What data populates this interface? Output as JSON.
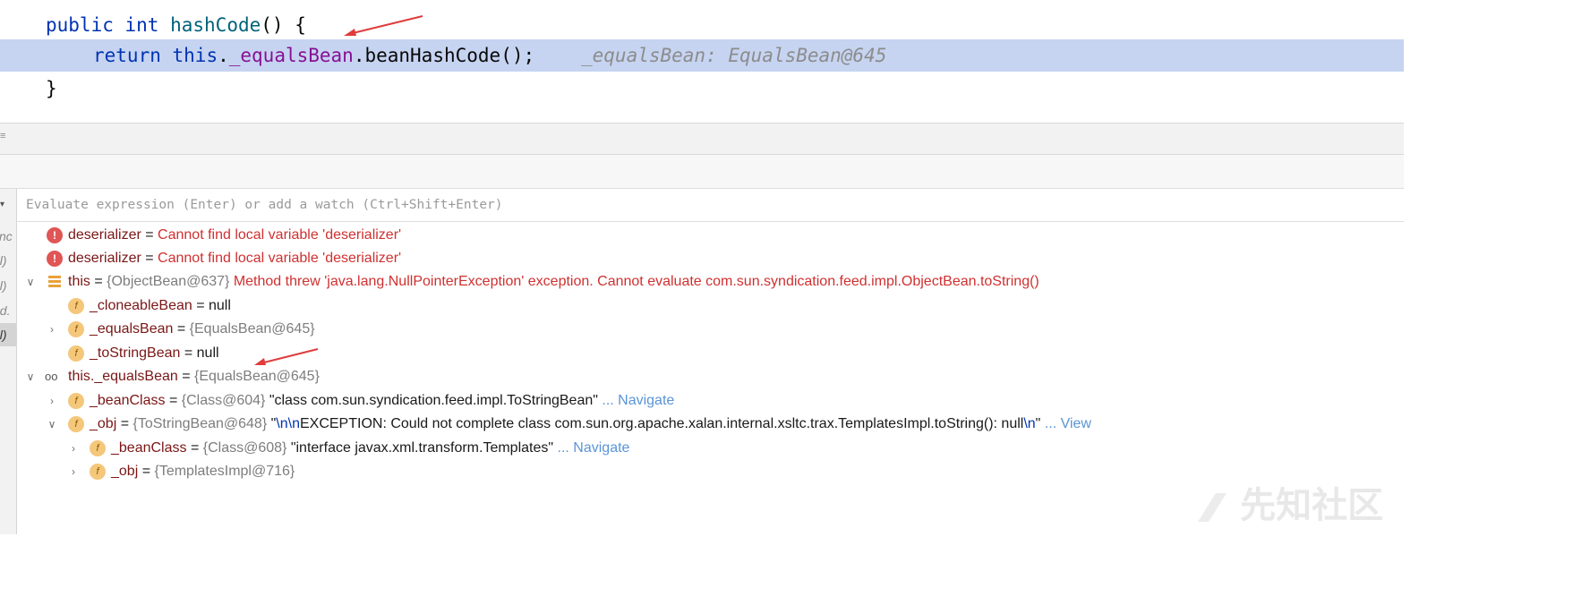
{
  "editor": {
    "line1": {
      "kw_public": "public",
      "kw_int": "int",
      "method_name": "hashCode",
      "rest": "() {"
    },
    "line2": {
      "kw_return": "return",
      "kw_this": "this",
      "dot1": ".",
      "field": "_equalsBean",
      "call": ".beanHashCode();",
      "inline_hint": "_equalsBean: EqualsBean@645"
    },
    "line3": {
      "brace": "}"
    }
  },
  "debugger": {
    "eval_placeholder": "Evaluate expression (Enter) or add a watch (Ctrl+Shift+Enter)",
    "frames_strip": [
      "ync",
      "ol)",
      "ol)",
      "ed.",
      "ol)"
    ],
    "variables": [
      {
        "name": "deserializer",
        "eq": " = ",
        "message": "Cannot find local variable 'deserializer'"
      },
      {
        "name": "deserializer",
        "eq": " = ",
        "message": "Cannot find local variable 'deserializer'"
      },
      {
        "name": "this",
        "eq": " = ",
        "ref": "{ObjectBean@637}",
        "message": " Method threw 'java.lang.NullPointerException' exception. Cannot evaluate com.sun.syndication.feed.impl.ObjectBean.toString()"
      },
      {
        "name": "_cloneableBean",
        "eq": " = ",
        "value": "null"
      },
      {
        "name": "_equalsBean",
        "eq": " = ",
        "ref": "{EqualsBean@645}"
      },
      {
        "name": "_toStringBean",
        "eq": " = ",
        "value": "null"
      },
      {
        "name": "this._equalsBean",
        "eq": " = ",
        "ref": "{EqualsBean@645}"
      },
      {
        "name": "_beanClass",
        "eq": " = ",
        "ref": "{Class@604}",
        "value": " \"class com.sun.syndication.feed.impl.ToStringBean\"",
        "link": " ... Navigate"
      },
      {
        "name": "_obj",
        "eq": " = ",
        "ref": "{ToStringBean@648}",
        "value_pre": " \"",
        "esc1": "\\n\\n",
        "value_mid": "EXCEPTION: Could not complete class com.sun.org.apache.xalan.internal.xsltc.trax.TemplatesImpl.toString(): null",
        "esc2": "\\n",
        "value_post": "\"",
        "link": " ... View"
      },
      {
        "name": "_beanClass",
        "eq": " = ",
        "ref": "{Class@608}",
        "value": " \"interface javax.xml.transform.Templates\"",
        "link": " ... Navigate"
      },
      {
        "name": "_obj",
        "eq": " = ",
        "ref": "{TemplatesImpl@716}"
      }
    ],
    "field_icon_letter": "f",
    "error_icon_glyph": "!"
  },
  "colors": {
    "highlight_line": "#c6d4f1",
    "error": "#d03030",
    "link": "#5a94d6",
    "annotation_arrow": "#e03c3c"
  },
  "watermark_text": "先知社区"
}
